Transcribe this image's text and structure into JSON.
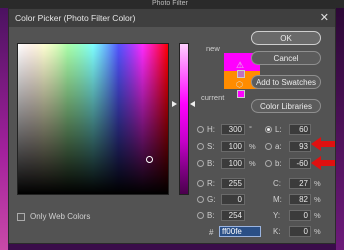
{
  "background": {
    "window_title": "Photo Filter"
  },
  "dialog": {
    "title": "Color Picker (Photo Filter Color)",
    "close_glyph": "✕"
  },
  "colors": {
    "new": "#ff00fe",
    "current": "#ff8c00",
    "web_safe": "#ff00ff",
    "annotation_arrow": "#e01010"
  },
  "swatch_labels": {
    "new": "new",
    "current": "current"
  },
  "buttons": {
    "ok": "OK",
    "cancel": "Cancel",
    "add_to_swatches": "Add to Swatches",
    "color_libraries": "Color Libraries"
  },
  "fields": {
    "H": {
      "label": "H:",
      "value": "300",
      "unit": "°"
    },
    "S": {
      "label": "S:",
      "value": "100",
      "unit": "%"
    },
    "B": {
      "label": "B:",
      "value": "100",
      "unit": "%"
    },
    "R": {
      "label": "R:",
      "value": "255"
    },
    "G": {
      "label": "G:",
      "value": "0"
    },
    "Bv": {
      "label": "B:",
      "value": "254"
    },
    "L": {
      "label": "L:",
      "value": "60"
    },
    "a": {
      "label": "a:",
      "value": "93"
    },
    "b": {
      "label": "b:",
      "value": "-60"
    },
    "C": {
      "label": "C:",
      "value": "27",
      "unit": "%"
    },
    "M": {
      "label": "M:",
      "value": "82",
      "unit": "%"
    },
    "Y": {
      "label": "Y:",
      "value": "0",
      "unit": "%"
    },
    "K": {
      "label": "K:",
      "value": "0",
      "unit": "%"
    },
    "hex": {
      "label": "#",
      "value": "ff00fe"
    }
  },
  "checkbox": {
    "label": "Only Web Colors",
    "checked": false
  },
  "selected_channel": "L"
}
